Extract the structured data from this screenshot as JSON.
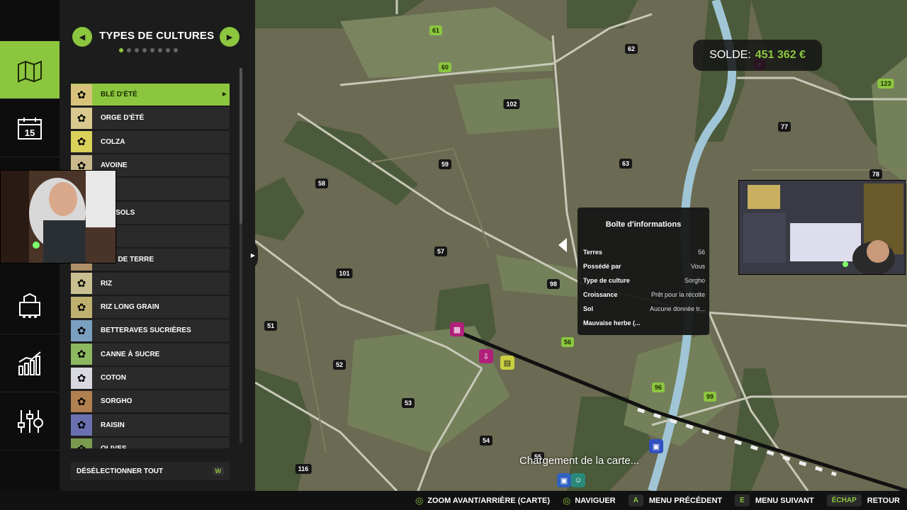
{
  "panel": {
    "title": "TYPES DE CULTURES",
    "prev_icon": "chevron-left-icon",
    "next_icon": "chevron-right-icon",
    "page_count": 8,
    "current_page": 1,
    "crops": [
      {
        "label": "BLÉ D'ÉTÉ",
        "icon": "wheat-icon",
        "color": "#d8c27a",
        "active": true
      },
      {
        "label": "ORGE D'ÉTÉ",
        "icon": "barley-icon",
        "color": "#d9c98e"
      },
      {
        "label": "COLZA",
        "icon": "canola-icon",
        "color": "#d9d15a"
      },
      {
        "label": "AVOINE",
        "icon": "oat-icon",
        "color": "#c9b88a"
      },
      {
        "label": "",
        "icon": "crop-icon",
        "color": "#9c8a5a"
      },
      {
        "label": "RNESOLS",
        "icon": "sunflower-icon",
        "color": "#e0c040"
      },
      {
        "label": "",
        "icon": "crop-icon",
        "color": "#9c8a5a"
      },
      {
        "label": "MES DE TERRE",
        "icon": "potato-icon",
        "color": "#b0906a"
      },
      {
        "label": "RIZ",
        "icon": "rice-icon",
        "color": "#c8c090"
      },
      {
        "label": "RIZ LONG GRAIN",
        "icon": "long-grain-rice-icon",
        "color": "#c0b070"
      },
      {
        "label": "BETTERAVES SUCRIÈRES",
        "icon": "sugar-beet-icon",
        "color": "#7aa0c0"
      },
      {
        "label": "CANNE À SUCRE",
        "icon": "sugarcane-icon",
        "color": "#8cb860"
      },
      {
        "label": "COTON",
        "icon": "cotton-icon",
        "color": "#d8d8e0"
      },
      {
        "label": "SORGHO",
        "icon": "sorghum-icon",
        "color": "#b08050"
      },
      {
        "label": "RAISIN",
        "icon": "grape-icon",
        "color": "#6a70b0"
      },
      {
        "label": "OLIVES",
        "icon": "olive-icon",
        "color": "#7a9a50"
      }
    ],
    "deselect_label": "DÉSÉLECTIONNER TOUT",
    "deselect_key": "W"
  },
  "rail": [
    {
      "icon": "map-icon",
      "active": true
    },
    {
      "icon": "calendar-icon",
      "text": "15"
    },
    {
      "icon": "chart-icon"
    },
    {
      "icon": "production-icon"
    },
    {
      "icon": "statistics-icon"
    },
    {
      "icon": "settings-icon"
    }
  ],
  "balance": {
    "label": "SOLDE:",
    "value": "451 362 €"
  },
  "info_box": {
    "title": "Boîte d'informations",
    "rows": [
      {
        "key": "Terres",
        "value": "56"
      },
      {
        "key": "Possédé par",
        "value": "Vous"
      },
      {
        "key": "Type de culture",
        "value": "Sorgho"
      },
      {
        "key": "Croissance",
        "value": "Prêt pour la récolte"
      },
      {
        "key": "Sol",
        "value": "Aucune donnée tr..."
      },
      {
        "key": "Mauvaise herbe (...",
        "value": ""
      }
    ]
  },
  "loading_text": "Chargement de la carte...",
  "field_labels": [
    {
      "text": "61",
      "green": true
    },
    {
      "text": "60",
      "green": true
    },
    {
      "text": "62"
    },
    {
      "text": "102"
    },
    {
      "text": "77"
    },
    {
      "text": "123",
      "green": true
    },
    {
      "text": "78"
    },
    {
      "text": "59"
    },
    {
      "text": "63"
    },
    {
      "text": "58"
    },
    {
      "text": "57"
    },
    {
      "text": "101"
    },
    {
      "text": "98"
    },
    {
      "text": "51"
    },
    {
      "text": "56",
      "green": true
    },
    {
      "text": "52"
    },
    {
      "text": "96",
      "green": true
    },
    {
      "text": "99",
      "green": true
    },
    {
      "text": "53"
    },
    {
      "text": "54"
    },
    {
      "text": "55"
    },
    {
      "text": "116"
    }
  ],
  "hints": [
    {
      "glyph": "stick-icon",
      "label": "ZOOM AVANT/ARRIÈRE (CARTE)"
    },
    {
      "glyph": "stick-icon",
      "label": "NAVIGUER"
    },
    {
      "key": "A",
      "label": "MENU PRÉCÉDENT"
    },
    {
      "key": "E",
      "label": "MENU SUIVANT"
    },
    {
      "key": "ÉCHAP",
      "label": "RETOUR"
    }
  ]
}
